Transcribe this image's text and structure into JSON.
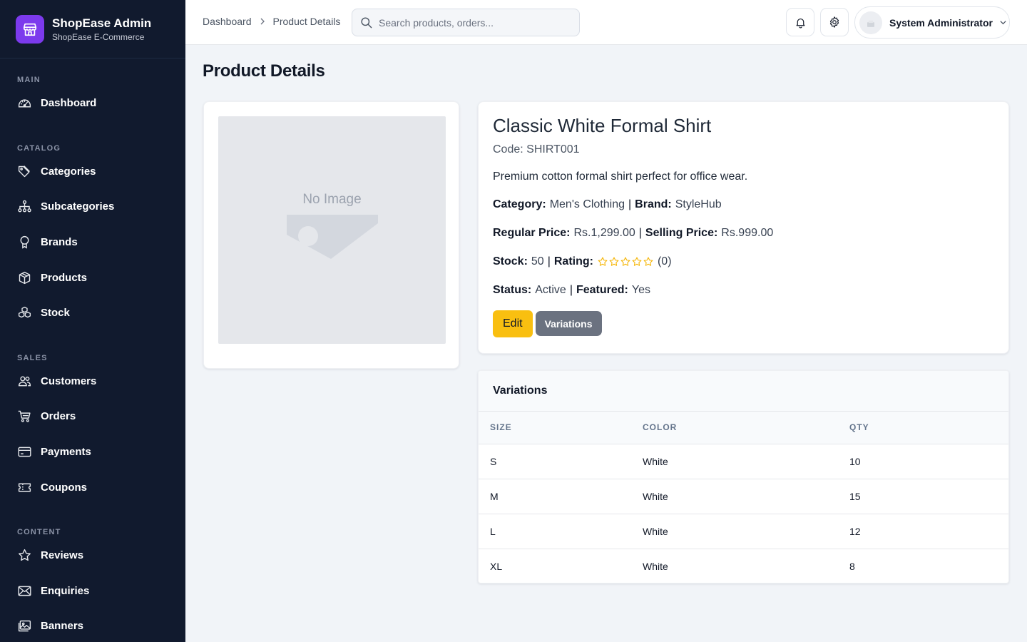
{
  "brand": {
    "name": "ShopEase Admin",
    "subtitle": "ShopEase E-Commerce",
    "logo_icon": "store-icon",
    "accent": "#7c3aed"
  },
  "sidebar": {
    "sections": [
      {
        "label": "MAIN",
        "items": [
          {
            "label": "Dashboard",
            "icon": "dashboard-icon"
          }
        ]
      },
      {
        "label": "CATALOG",
        "items": [
          {
            "label": "Categories",
            "icon": "tag-icon"
          },
          {
            "label": "Subcategories",
            "icon": "hierarchy-icon"
          },
          {
            "label": "Brands",
            "icon": "badge-icon"
          },
          {
            "label": "Products",
            "icon": "box-icon"
          },
          {
            "label": "Stock",
            "icon": "boxes-icon"
          }
        ]
      },
      {
        "label": "SALES",
        "items": [
          {
            "label": "Customers",
            "icon": "users-icon"
          },
          {
            "label": "Orders",
            "icon": "cart-icon"
          },
          {
            "label": "Payments",
            "icon": "credit-card-icon"
          },
          {
            "label": "Coupons",
            "icon": "ticket-icon"
          }
        ]
      },
      {
        "label": "CONTENT",
        "items": [
          {
            "label": "Reviews",
            "icon": "star-icon"
          },
          {
            "label": "Enquiries",
            "icon": "envelope-icon"
          },
          {
            "label": "Banners",
            "icon": "images-icon"
          }
        ]
      }
    ]
  },
  "header": {
    "breadcrumb": [
      "Dashboard",
      "Product Details"
    ],
    "search_placeholder": "Search products, orders...",
    "user_name": "System Administrator"
  },
  "page": {
    "title": "Product Details"
  },
  "product": {
    "image_placeholder": "No Image",
    "name": "Classic White Formal Shirt",
    "code": "Code: SHIRT001",
    "description": "Premium cotton formal shirt perfect for office wear.",
    "category_label": "Category:",
    "category": "Men's Clothing",
    "brand_label": "Brand:",
    "brand": "StyleHub",
    "regular_price_label": "Regular Price:",
    "regular_price": "Rs.1,299.00",
    "selling_price_label": "Selling Price:",
    "selling_price": "Rs.999.00",
    "stock_label": "Stock:",
    "stock": "50",
    "rating_label": "Rating:",
    "rating_stars": 0,
    "rating_max": 5,
    "rating_count": "(0)",
    "status_label": "Status:",
    "status": "Active",
    "featured_label": "Featured:",
    "featured": "Yes",
    "separator": "|",
    "edit_button": "Edit",
    "variations_button": "Variations",
    "colors": {
      "edit": "#f9bf10",
      "variations": "#6b7280",
      "star": "#f5b400"
    }
  },
  "variations": {
    "title": "Variations",
    "columns": [
      "SIZE",
      "COLOR",
      "QTY"
    ],
    "rows": [
      [
        "S",
        "White",
        "10"
      ],
      [
        "M",
        "White",
        "15"
      ],
      [
        "L",
        "White",
        "12"
      ],
      [
        "XL",
        "White",
        "8"
      ]
    ]
  }
}
